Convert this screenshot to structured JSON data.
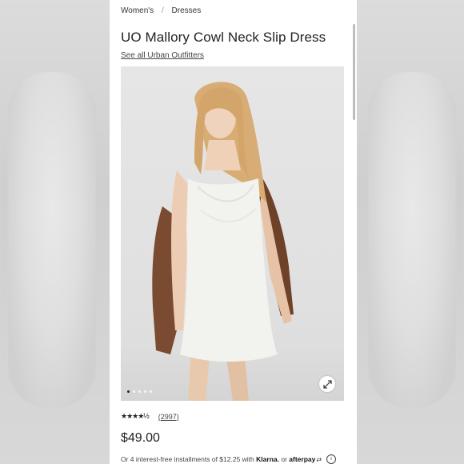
{
  "breadcrumb": {
    "items": [
      "Women's",
      "Dresses"
    ],
    "separator": "/"
  },
  "product": {
    "title": "UO Mallory Cowl Neck Slip Dress",
    "brand_link": "See all Urban Outfitters",
    "rating_stars": "★★★★½",
    "rating_value": 4.5,
    "review_count": "(2997)",
    "price": "$49.00"
  },
  "installments": {
    "prefix": "Or 4 interest-free installments of $12.25 with",
    "klarna": "Klarna.",
    "or": "or",
    "afterpay": "afterpay"
  },
  "gallery": {
    "total_images": 5,
    "active_index": 0,
    "zoom_icon": "expand-icon"
  },
  "icons": {
    "info": "info-icon"
  }
}
